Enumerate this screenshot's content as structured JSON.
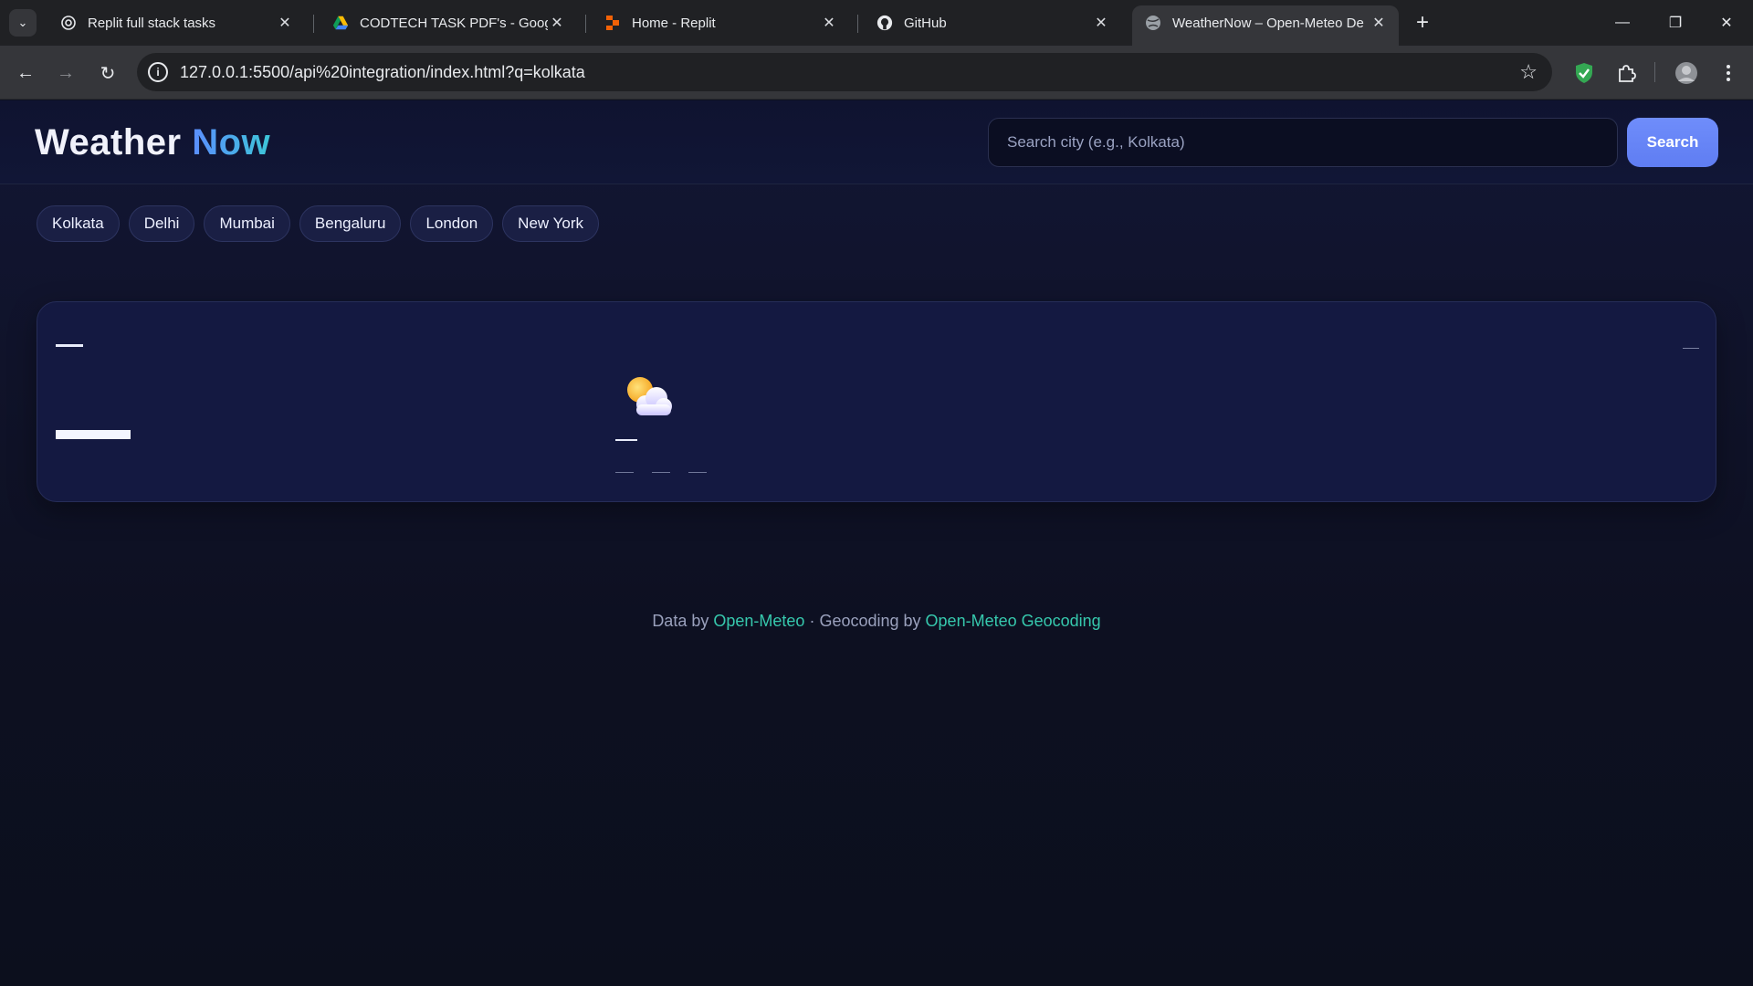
{
  "browser": {
    "tabs": [
      {
        "title": "Replit full stack tasks",
        "icon": "openai-icon"
      },
      {
        "title": "CODTECH TASK PDF's - Google",
        "icon": "google-drive-icon"
      },
      {
        "title": "Home - Replit",
        "icon": "replit-icon"
      },
      {
        "title": "GitHub",
        "icon": "github-icon"
      },
      {
        "title": "WeatherNow – Open-Meteo De",
        "icon": "globe-icon",
        "active": true
      }
    ],
    "url": "127.0.0.1:5500/api%20integration/index.html?q=kolkata"
  },
  "app": {
    "brand_part1": "Weather",
    "brand_part2": "Now",
    "search_placeholder": "Search city (e.g., Kolkata)",
    "search_button": "Search",
    "chips": [
      "Kolkata",
      "Delhi",
      "Mumbai",
      "Bengaluru",
      "London",
      "New York"
    ],
    "weather_icon": "partly-cloudy-icon"
  },
  "footer": {
    "prefix": "Data by",
    "link1": "Open-Meteo",
    "middle": "· Geocoding by",
    "link2": "Open-Meteo Geocoding"
  },
  "colors": {
    "accent": "#6b89f9",
    "link": "#36c8ad",
    "background": "#0e1120"
  }
}
